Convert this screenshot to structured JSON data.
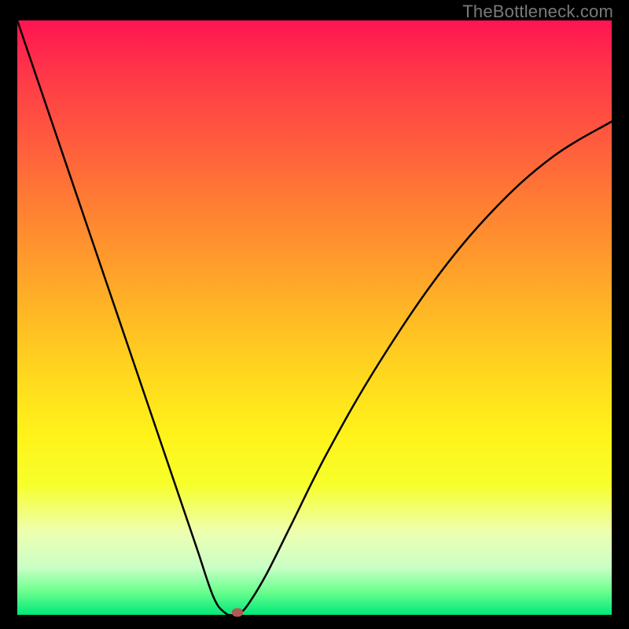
{
  "attribution": {
    "text": "TheBottleneck.com"
  },
  "chart_data": {
    "type": "line",
    "title": "",
    "xlabel": "",
    "ylabel": "",
    "xlim": [
      0,
      100
    ],
    "ylim": [
      0,
      100
    ],
    "grid": false,
    "legend": false,
    "series": [
      {
        "name": "bottleneck-curve",
        "x": [
          0,
          5,
          10,
          15,
          20,
          25,
          30,
          33,
          35,
          36.5,
          37.5,
          39,
          42,
          46,
          52,
          60,
          70,
          80,
          90,
          100
        ],
        "y": [
          100,
          85.3,
          70.6,
          55.9,
          41.2,
          26.5,
          11.8,
          3,
          0.3,
          0,
          0.3,
          2,
          7,
          15,
          27,
          41,
          56,
          68,
          77,
          83
        ]
      }
    ],
    "marker": {
      "x": 37,
      "y": 0
    },
    "gradient_stops": [
      {
        "pos": 0,
        "color": "#ff1452"
      },
      {
        "pos": 10,
        "color": "#ff3b47"
      },
      {
        "pos": 20,
        "color": "#ff5a3e"
      },
      {
        "pos": 30,
        "color": "#ff7b34"
      },
      {
        "pos": 40,
        "color": "#ff9a2c"
      },
      {
        "pos": 50,
        "color": "#ffba24"
      },
      {
        "pos": 60,
        "color": "#ffd91e"
      },
      {
        "pos": 70,
        "color": "#fff31a"
      },
      {
        "pos": 78,
        "color": "#f7ff2a"
      },
      {
        "pos": 86,
        "color": "#eeffb0"
      },
      {
        "pos": 92,
        "color": "#caffc6"
      },
      {
        "pos": 96,
        "color": "#6dff8f"
      },
      {
        "pos": 100,
        "color": "#00e87a"
      }
    ]
  }
}
